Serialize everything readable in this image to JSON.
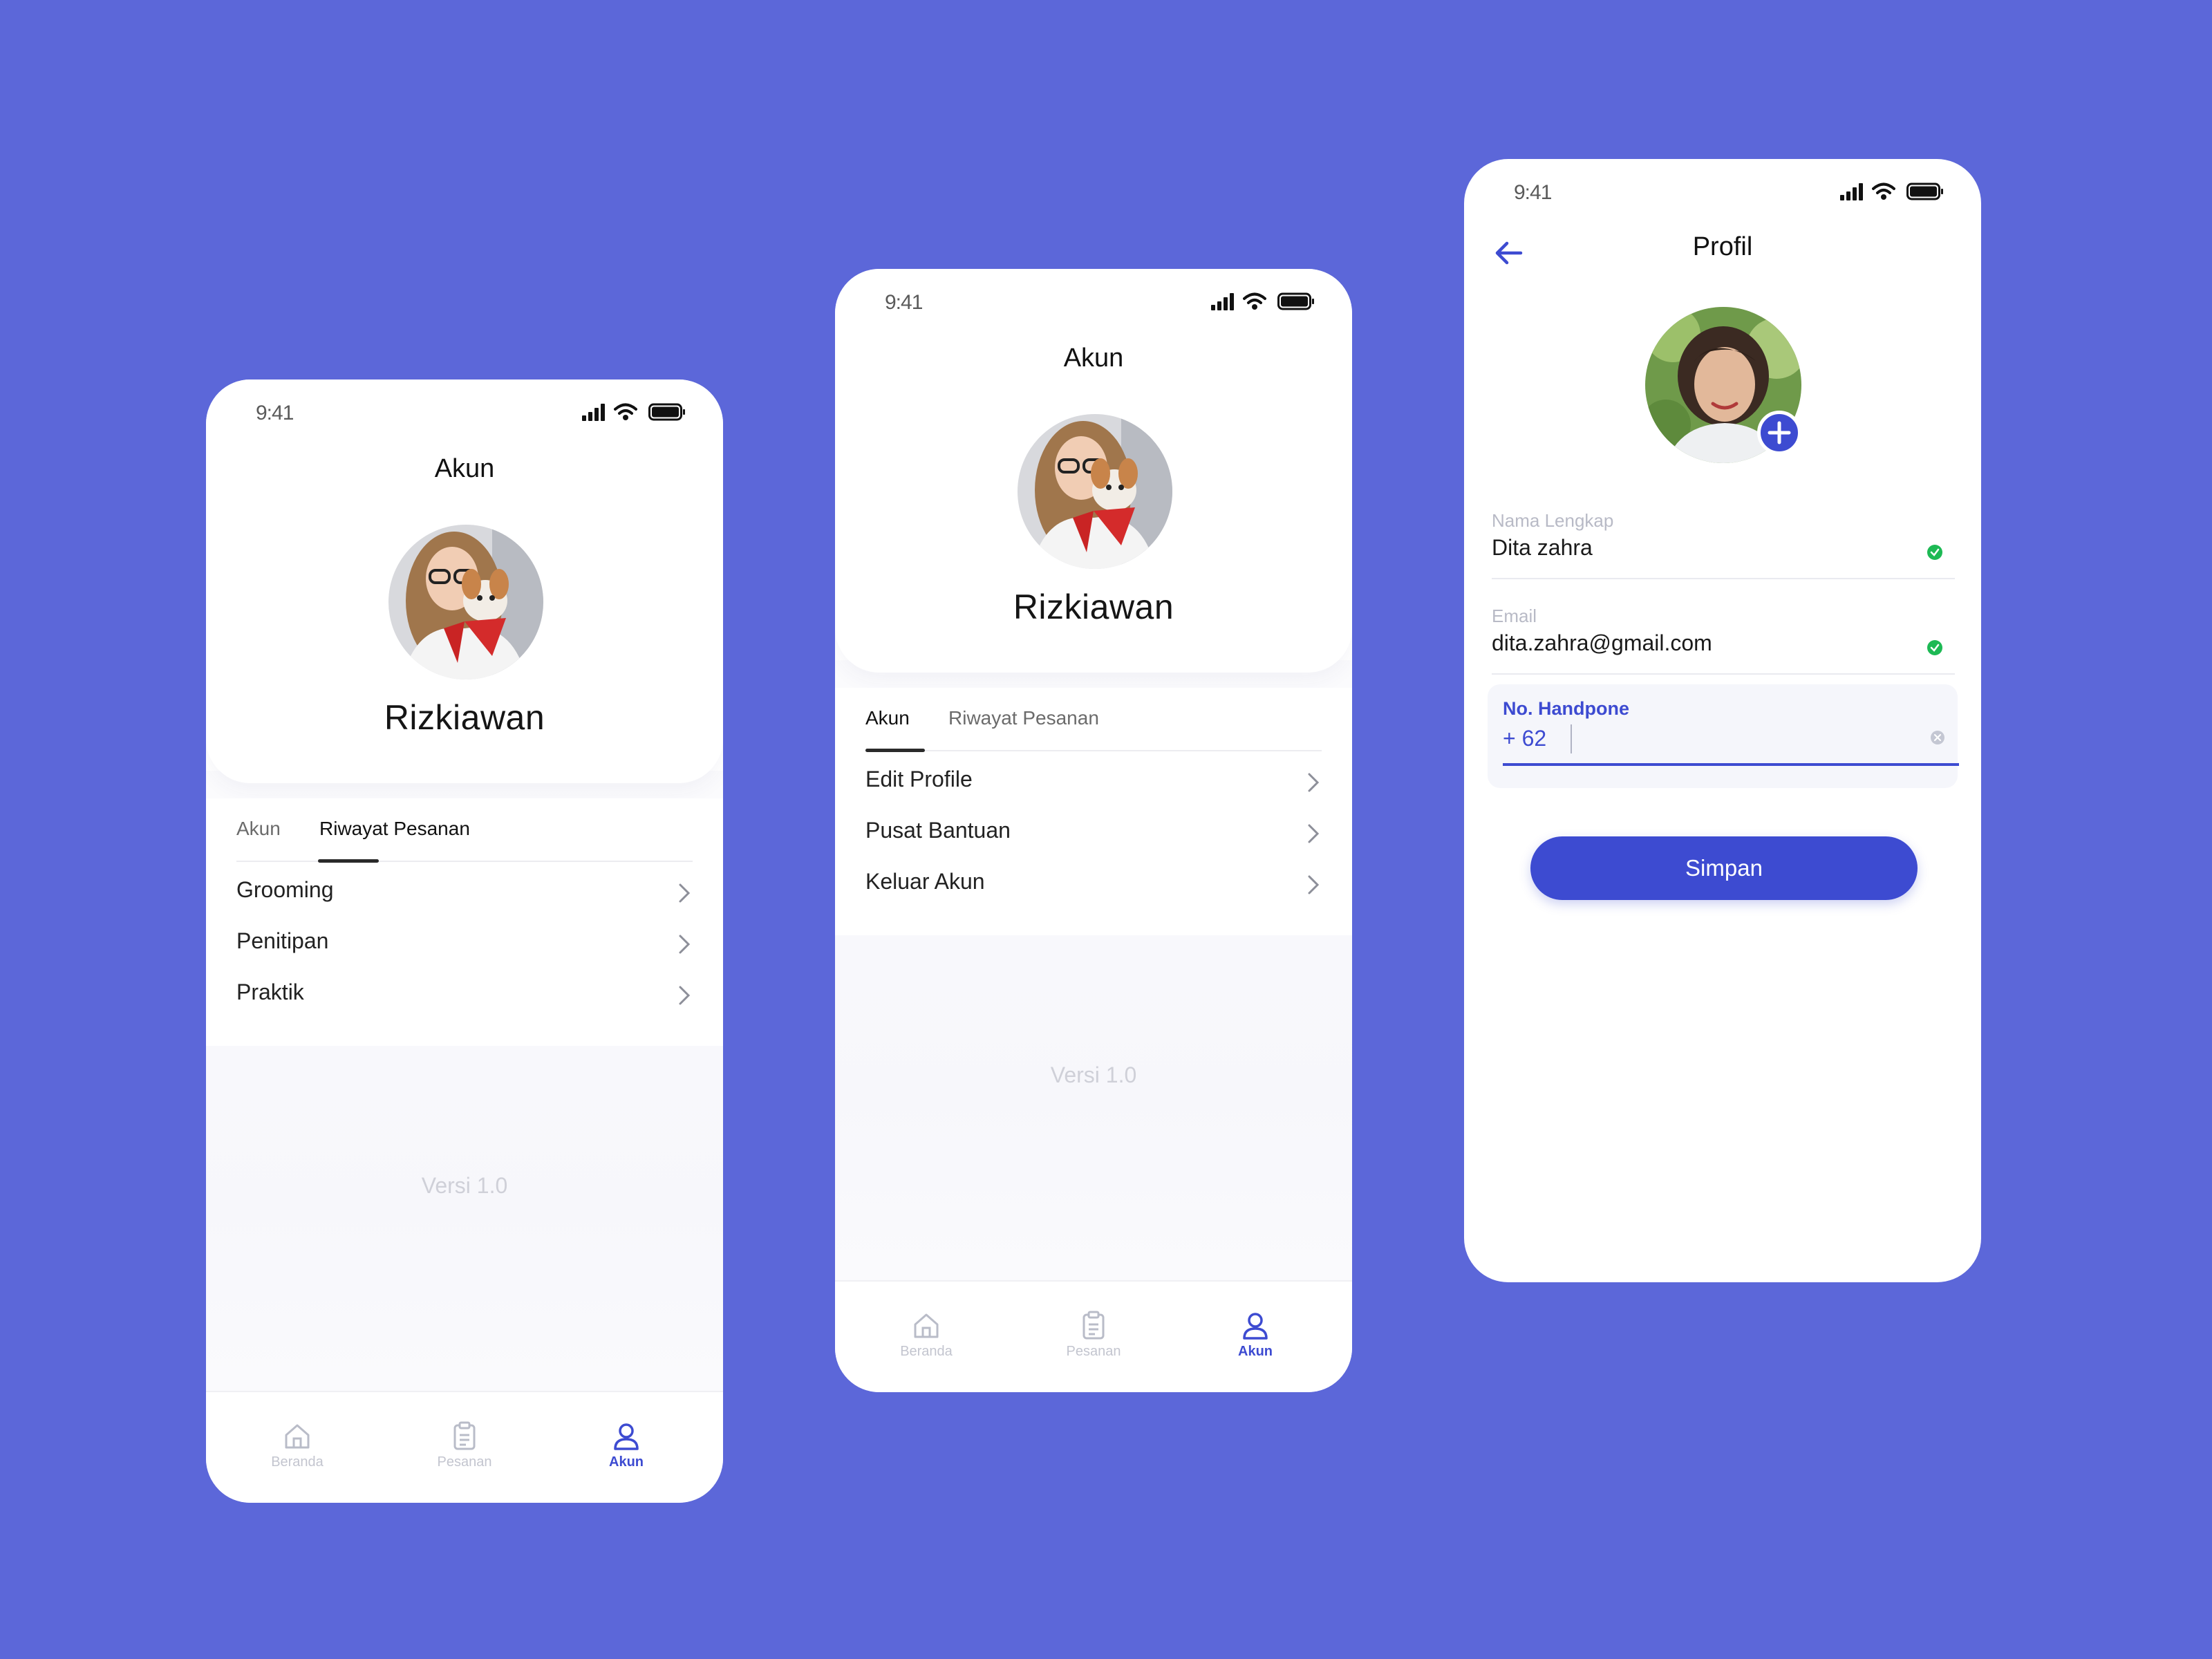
{
  "status": {
    "time": "9:41"
  },
  "screen_history": {
    "title": "Akun",
    "name": "Rizkiawan",
    "tabs": [
      "Akun",
      "Riwayat Pesanan"
    ],
    "active_tab": "Riwayat Pesanan",
    "menu": [
      "Grooming",
      "Penitipan",
      "Praktik"
    ],
    "version": "Versi 1.0"
  },
  "screen_account": {
    "title": "Akun",
    "name": "Rizkiawan",
    "tabs": [
      "Akun",
      "Riwayat Pesanan"
    ],
    "active_tab": "Akun",
    "menu": [
      "Edit Profile",
      "Pusat Bantuan",
      "Keluar Akun"
    ],
    "version": "Versi 1.0"
  },
  "bottom_nav": {
    "items": [
      "Beranda",
      "Pesanan",
      "Akun"
    ],
    "active": "Akun"
  },
  "screen_profile": {
    "title": "Profil",
    "fields": [
      {
        "label": "Nama Lengkap",
        "value": "Dita zahra",
        "valid": true
      },
      {
        "label": "Email",
        "value": "dita.zahra@gmail.com",
        "valid": true
      }
    ],
    "phone_field": {
      "label": "No. Handpone",
      "prefix": "+ 62",
      "value": ""
    },
    "save_label": "Simpan"
  },
  "colors": {
    "background": "#5c67d9",
    "accent": "#3d4bd1",
    "success": "#1db954"
  }
}
